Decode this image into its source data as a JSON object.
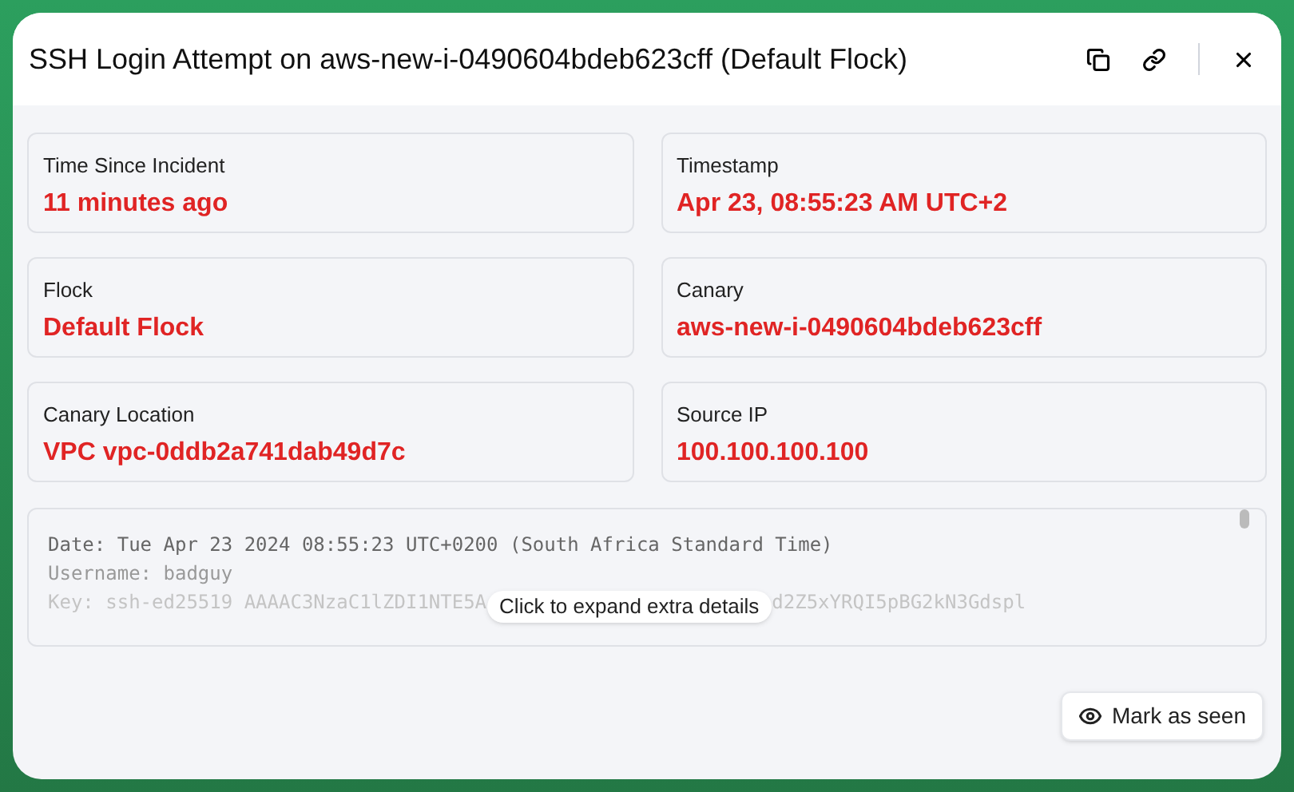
{
  "dialog": {
    "title": "SSH Login Attempt on aws-new-i-0490604bdeb623cff (Default Flock)"
  },
  "fields": [
    {
      "label": "Time Since Incident",
      "value": "11 minutes ago"
    },
    {
      "label": "Timestamp",
      "value": "Apr 23, 08:55:23 AM UTC+2"
    },
    {
      "label": "Flock",
      "value": "Default Flock"
    },
    {
      "label": "Canary",
      "value": "aws-new-i-0490604bdeb623cff"
    },
    {
      "label": "Canary Location",
      "value": "VPC vpc-0ddb2a741dab49d7c"
    },
    {
      "label": "Source IP",
      "value": "100.100.100.100"
    }
  ],
  "details": {
    "lines": [
      "Date: Tue Apr 23 2024 08:55:23 UTC+0200 (South Africa Standard Time)",
      "Username: badguy"
    ],
    "key_start": "Key: ssh-ed25519 AAAAC3NzaC1lZDI1NTE5A",
    "key_end": "d2Z5xYRQI5pBG2kN3Gdspl",
    "tooltip": "Click to expand extra details"
  },
  "mark_seen_button": "Mark as seen"
}
